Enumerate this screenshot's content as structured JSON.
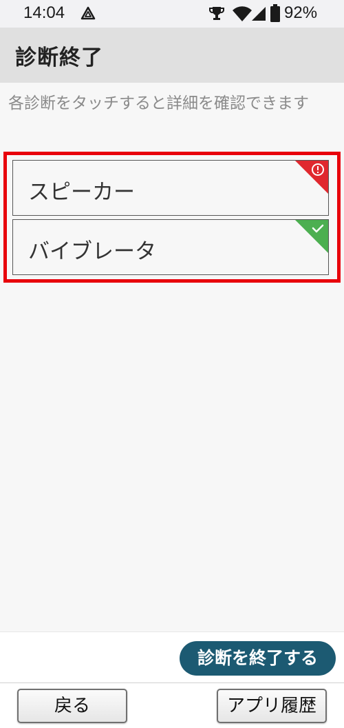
{
  "status_bar": {
    "time": "14:04",
    "battery": "92%",
    "icons": [
      "triangle-alert-icon",
      "trophy-icon",
      "wifi-icon",
      "cell-signal-icon",
      "battery-icon"
    ]
  },
  "header": {
    "title": "診断終了"
  },
  "instruction": "各診断をタッチすると詳細を確認できます",
  "results": [
    {
      "label": "スピーカー",
      "status": "error",
      "icon": "error-icon",
      "color": "#e0282e"
    },
    {
      "label": "バイブレータ",
      "status": "ok",
      "icon": "check-icon",
      "color": "#4caf50"
    }
  ],
  "footer": {
    "end_button": "診断を終了する"
  },
  "bottom_bar": {
    "back": "戻る",
    "history": "アプリ履歴"
  },
  "colors": {
    "accent": "#1c5a72",
    "highlight": "#e8000b",
    "header_bg": "#e0e0e0"
  }
}
